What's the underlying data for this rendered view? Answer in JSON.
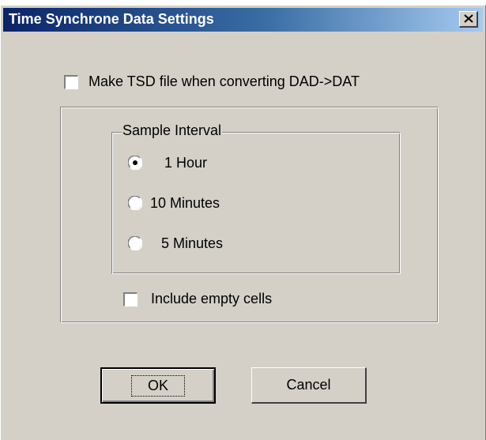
{
  "window": {
    "title": "Time Synchrone Data Settings"
  },
  "make_tsd": {
    "label": "Make TSD file when converting DAD->DAT",
    "checked": false
  },
  "sample_interval": {
    "legend": "Sample Interval",
    "options": [
      {
        "label": "1 Hour",
        "selected": true
      },
      {
        "label": "10 Minutes",
        "selected": false
      },
      {
        "label": "5 Minutes",
        "selected": false
      }
    ]
  },
  "include_empty": {
    "label": "Include empty cells",
    "checked": false
  },
  "buttons": {
    "ok": "OK",
    "cancel": "Cancel"
  },
  "icons": {
    "close": "close-icon"
  }
}
